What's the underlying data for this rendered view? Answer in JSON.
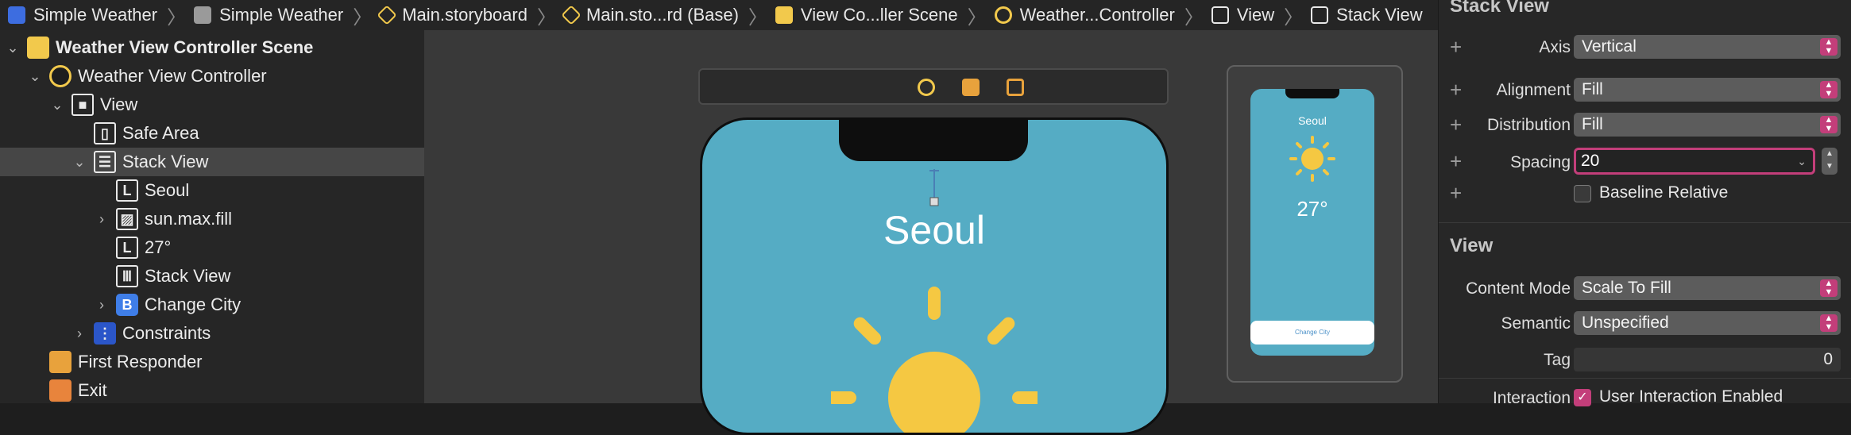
{
  "breadcrumb": {
    "items": [
      {
        "label": "Simple Weather",
        "icon": "app-icon"
      },
      {
        "label": "Simple Weather",
        "icon": "folder-icon"
      },
      {
        "label": "Main.storyboard",
        "icon": "storyboard-icon"
      },
      {
        "label": "Main.sto...rd (Base)",
        "icon": "storyboard-icon"
      },
      {
        "label": "View Co...ller Scene",
        "icon": "scene-icon"
      },
      {
        "label": "Weather...Controller",
        "icon": "view-controller-icon"
      },
      {
        "label": "View",
        "icon": "view-icon"
      },
      {
        "label": "Stack View",
        "icon": "stack-view-icon"
      }
    ]
  },
  "outline": {
    "items": [
      {
        "label": "Weather View Controller Scene",
        "icon": "scene-icon",
        "chevron": "down",
        "indent": 0,
        "selected": false,
        "bold": true
      },
      {
        "label": "Weather View Controller",
        "icon": "view-controller-icon",
        "chevron": "down",
        "indent": 1,
        "selected": false
      },
      {
        "label": "View",
        "icon": "view-icon",
        "chevron": "down",
        "indent": 2,
        "selected": false
      },
      {
        "label": "Safe Area",
        "icon": "safe-area-icon",
        "chevron": "none",
        "indent": 3,
        "selected": false
      },
      {
        "label": "Stack View",
        "icon": "stack-view-icon",
        "chevron": "down",
        "indent": 3,
        "selected": true
      },
      {
        "label": "Seoul",
        "icon": "label-icon",
        "chevron": "none",
        "indent": 4,
        "selected": false
      },
      {
        "label": "sun.max.fill",
        "icon": "image-view-icon",
        "chevron": "right",
        "indent": 4,
        "selected": false
      },
      {
        "label": "27°",
        "icon": "label-icon",
        "chevron": "none",
        "indent": 4,
        "selected": false
      },
      {
        "label": "Stack View",
        "icon": "horizontal-stack-icon",
        "chevron": "none",
        "indent": 4,
        "selected": false
      },
      {
        "label": "Change City",
        "icon": "button-icon",
        "chevron": "right",
        "indent": 4,
        "selected": false
      },
      {
        "label": "Constraints",
        "icon": "constraints-icon",
        "chevron": "right",
        "indent": 3,
        "selected": false
      },
      {
        "label": "First Responder",
        "icon": "first-responder-icon",
        "chevron": "none",
        "indent": 1,
        "selected": false
      },
      {
        "label": "Exit",
        "icon": "exit-icon",
        "chevron": "none",
        "indent": 1,
        "selected": false
      }
    ]
  },
  "canvas": {
    "scene_bar_icons": [
      "view-controller-icon",
      "first-responder-icon",
      "exit-icon"
    ],
    "city": "Seoul"
  },
  "preview": {
    "city": "Seoul",
    "temperature": "27°",
    "button_label": "Change City"
  },
  "inspector": {
    "stack_view_title": "Stack View",
    "axis_label": "Axis",
    "axis_value": "Vertical",
    "alignment_label": "Alignment",
    "alignment_value": "Fill",
    "distribution_label": "Distribution",
    "distribution_value": "Fill",
    "spacing_label": "Spacing",
    "spacing_value": "20",
    "baseline_label": "Baseline Relative",
    "view_title": "View",
    "content_mode_label": "Content Mode",
    "content_mode_value": "Scale To Fill",
    "semantic_label": "Semantic",
    "semantic_value": "Unspecified",
    "tag_label": "Tag",
    "tag_value": "0",
    "interaction_label": "Interaction",
    "user_interaction_label": "User Interaction Enabled",
    "user_interaction_checked": true
  },
  "colors": {
    "accent": "#c33e7a",
    "phone_bg": "#55acc4",
    "sun": "#f5c842",
    "scene_icon": "#f2c94c"
  }
}
